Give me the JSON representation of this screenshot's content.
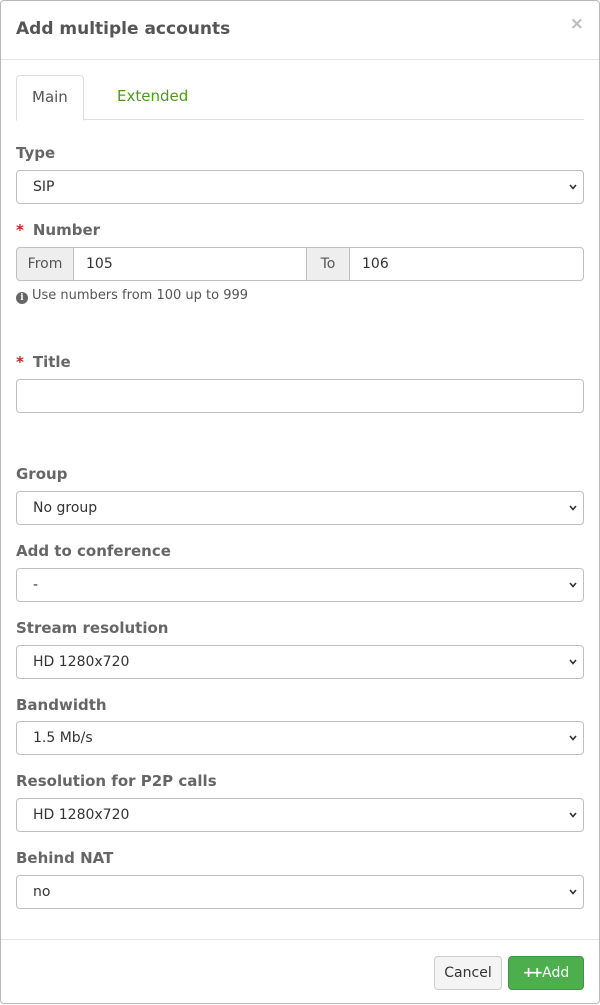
{
  "modal": {
    "title": "Add multiple accounts",
    "close_label": "×"
  },
  "tabs": [
    {
      "label": "Main",
      "active": true
    },
    {
      "label": "Extended",
      "active": false
    }
  ],
  "fields": {
    "type": {
      "label": "Type",
      "value": "SIP"
    },
    "number": {
      "label": "Number",
      "required_mark": "*",
      "from_label": "From",
      "from_value": "105",
      "to_label": "To",
      "to_value": "106",
      "help": "Use numbers from 100 up to 999"
    },
    "title": {
      "label": "Title",
      "required_mark": "*",
      "value": ""
    },
    "group": {
      "label": "Group",
      "value": "No group"
    },
    "conference": {
      "label": "Add to conference",
      "value": "-"
    },
    "stream_resolution": {
      "label": "Stream resolution",
      "value": "HD 1280x720"
    },
    "bandwidth": {
      "label": "Bandwidth",
      "value": "1.5 Mb/s"
    },
    "p2p_resolution": {
      "label": "Resolution for P2P calls",
      "value": "HD 1280x720"
    },
    "behind_nat": {
      "label": "Behind NAT",
      "value": "no"
    }
  },
  "footer": {
    "cancel_label": "Cancel",
    "add_label": "Add"
  },
  "colors": {
    "accent_green": "#4cae4c",
    "tab_link": "#4f9a1d",
    "required": "#d0211c"
  }
}
